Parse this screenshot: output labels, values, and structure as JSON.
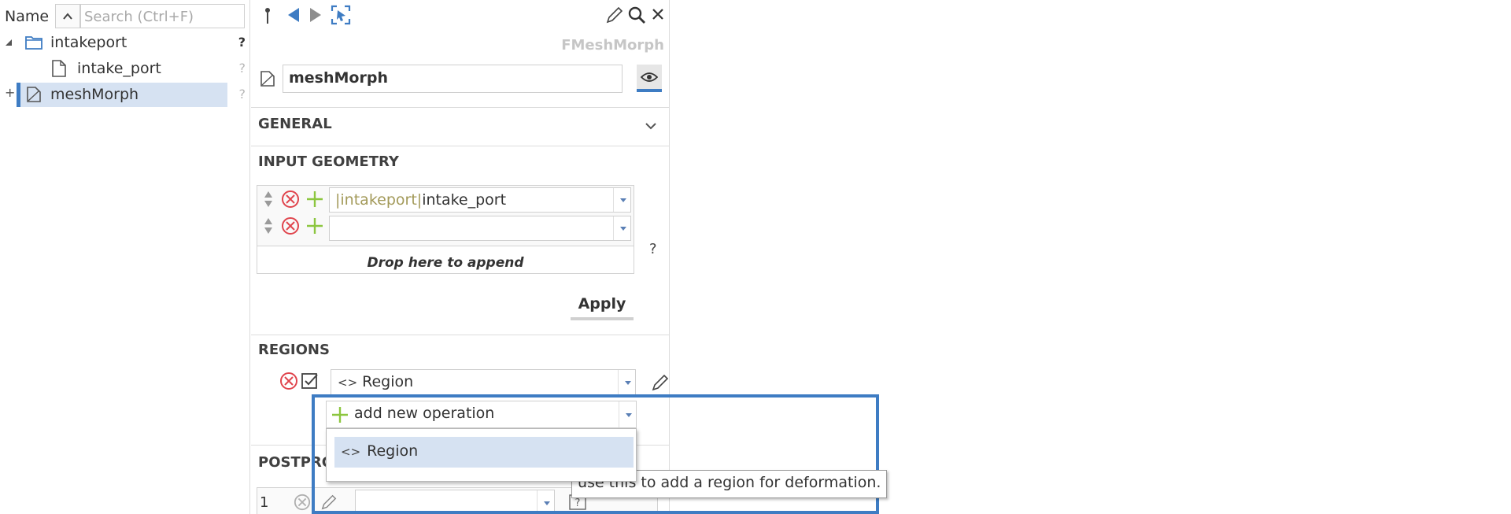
{
  "tree": {
    "header_label": "Name",
    "search_placeholder": "Search (Ctrl+F)",
    "items": [
      {
        "label": "intakeport",
        "status": "?",
        "icon": "folder-icon",
        "expanded": true
      },
      {
        "label": "intake_port",
        "status": "?",
        "icon": "file-icon"
      },
      {
        "label": "meshMorph",
        "status": "?",
        "icon": "mesh-morph-icon",
        "selected": true
      }
    ]
  },
  "toolbar": {
    "pin_icon": "pin-icon",
    "back_icon": "arrow-left-icon",
    "forward_icon": "arrow-right-icon",
    "select_icon": "select-target-icon",
    "edit_icon": "pencil-icon",
    "search_icon": "search-icon",
    "close_icon": "close-icon"
  },
  "panel": {
    "type_label": "FMeshMorph",
    "name_value": "meshMorph"
  },
  "general": {
    "title": "GENERAL"
  },
  "input_geometry": {
    "title": "INPUT GEOMETRY",
    "rows": [
      {
        "path_prefix": "|intakeport|",
        "value": "intake_port"
      },
      {
        "path_prefix": "",
        "value": ""
      }
    ],
    "drop_text": "Drop here to append",
    "help": "?",
    "apply_label": "Apply"
  },
  "regions": {
    "title": "REGIONS",
    "region_value": "Region",
    "add_operation_label": "add new operation",
    "dropdown_options": [
      "Region"
    ],
    "tooltip": "use this to add a region for deformation."
  },
  "postprocess": {
    "title_visible": "POSTPRC",
    "row_index": "1"
  },
  "colors": {
    "accent_blue": "#3e7cc3",
    "selection": "#d6e2f2",
    "remove_red": "#e0454d",
    "add_green": "#8cc63f",
    "path_olive": "#a39a5a"
  }
}
